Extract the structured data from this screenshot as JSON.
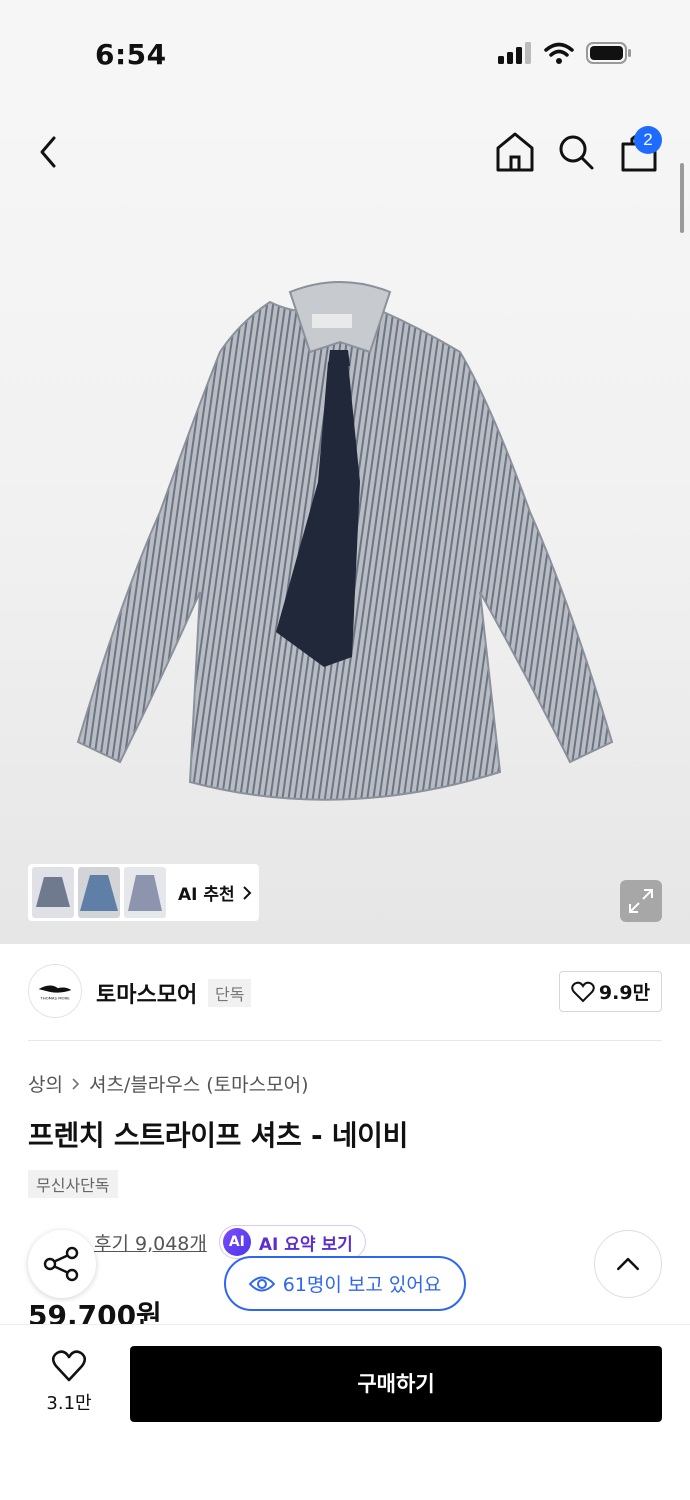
{
  "status_bar": {
    "time": "6:54"
  },
  "nav": {
    "cart_count": "2",
    "icons": [
      "back-icon",
      "home-icon",
      "search-icon",
      "cart-icon"
    ]
  },
  "gallery": {
    "ai_recommend_label": "AI 추천"
  },
  "brand": {
    "name": "토마스모어",
    "badge": "단독",
    "likes": "9.9만",
    "logo_text": "THOMAS MORE"
  },
  "breadcrumb": {
    "category": "상의",
    "subcategory": "셔츠/블라우스 (토마스모어)"
  },
  "product": {
    "title": "프렌치 스트라이프 셔츠 - 네이비",
    "tag": "무신사단독",
    "reviews": "후기 9,048개",
    "ai_summary": "AI 요약 보기",
    "ai_badge": "AI",
    "price": "59,700원"
  },
  "viewers_text": "61명이 보고 있어요",
  "bottom_bar": {
    "wish_count": "3.1만",
    "buy_label": "구매하기"
  },
  "colors": {
    "accent_blue": "#2f67f0",
    "ai_purple": "#5d2fd0",
    "buy_black": "#000000"
  }
}
